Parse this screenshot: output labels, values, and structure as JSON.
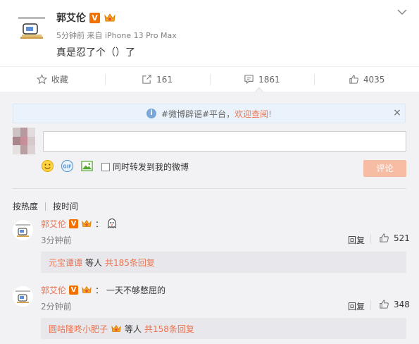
{
  "post": {
    "author": "郭艾伦",
    "verified_badge": "V",
    "meta": "5分钟前 来自 iPhone 13 Pro Max",
    "text": "真是忍了个（）了"
  },
  "actions": [
    {
      "icon": "star-icon",
      "label": "收藏"
    },
    {
      "icon": "share-icon",
      "label": "161"
    },
    {
      "icon": "comment-icon",
      "label": "1861"
    },
    {
      "icon": "thumbs-up-icon",
      "label": "4035"
    }
  ],
  "notice": {
    "prefix": "#微博辟谣#平台，",
    "link": "欢迎查阅!",
    "close": "×"
  },
  "composer": {
    "placeholder": "",
    "repost_label": "同时转发到我的微博",
    "submit_label": "评论"
  },
  "sort": {
    "hot": "按热度",
    "time": "按时间"
  },
  "comments": [
    {
      "name": "郭艾伦",
      "badge": "V",
      "sep": "：",
      "text": "",
      "emoji": "ghost-emoji",
      "time": "3分钟前",
      "reply": "回复",
      "likes": "521",
      "sub_name": "元宝谭谭",
      "sub_mid": "等人",
      "sub_count": "共185条回复"
    },
    {
      "name": "郭艾伦",
      "badge": "V",
      "sep": "：",
      "text": "一天不够憋屈的",
      "time": "2分钟前",
      "reply": "回复",
      "likes": "348",
      "sub_name": "圆咕隆咚小肥子",
      "sub_mid": "等人",
      "sub_count": "共158条回复"
    }
  ],
  "colors": {
    "accent": "#eb7350",
    "verified": "#f27000",
    "button": "#f6bca4"
  }
}
